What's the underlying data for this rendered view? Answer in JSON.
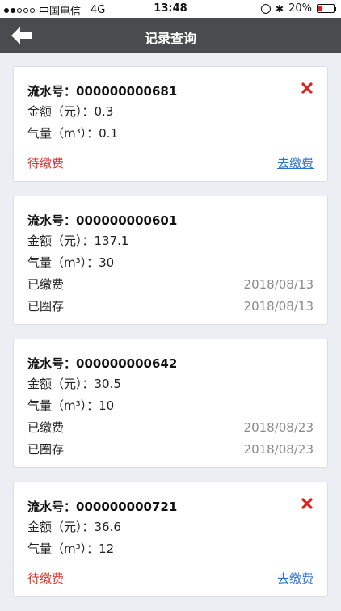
{
  "status_bar": {
    "carrier": "中国电信",
    "network": "4G",
    "time": "13:48",
    "battery": "20%",
    "battery_level": 0.2,
    "icons": [
      "signal-dots-icon",
      "orientation-lock-icon",
      "bluetooth-icon",
      "battery-icon"
    ]
  },
  "nav": {
    "title": "记录查询",
    "back_icon": "back-arrow-icon"
  },
  "labels": {
    "serial": "流水号：",
    "amount": "金额（元）：",
    "gas": "气量（m³）：",
    "pending": "待缴费",
    "pay_link": "去缴费",
    "paid": "已缴费",
    "loaded": "已圈存"
  },
  "colors": {
    "nav_bg": "#4a4b4f",
    "pending": "#d93025",
    "link": "#2b73c8",
    "delete": "#e0201a",
    "date": "#8a8a8a"
  },
  "records": [
    {
      "serial": "000000000681",
      "amount": "0.3",
      "gas": "0.1",
      "status": "pending",
      "deletable": true
    },
    {
      "serial": "000000000601",
      "amount": "137.1",
      "gas": "30",
      "status": "done",
      "paid_date": "2018/08/13",
      "loaded_date": "2018/08/13"
    },
    {
      "serial": "000000000642",
      "amount": "30.5",
      "gas": "10",
      "status": "done",
      "paid_date": "2018/08/23",
      "loaded_date": "2018/08/23"
    },
    {
      "serial": "000000000721",
      "amount": "36.6",
      "gas": "12",
      "status": "pending",
      "deletable": true
    }
  ]
}
